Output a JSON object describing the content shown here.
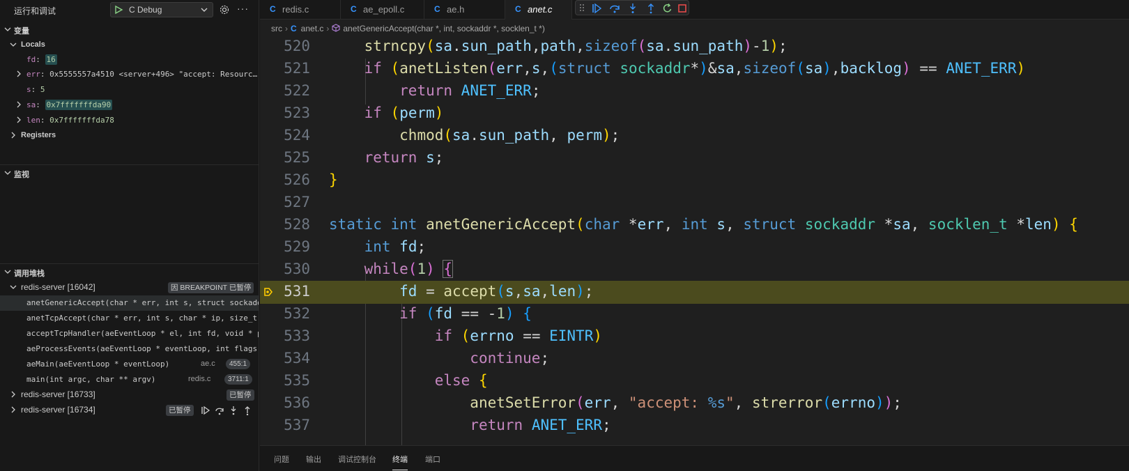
{
  "sidebar": {
    "title": "运行和调试",
    "config": "C Debug",
    "variables": {
      "title": "变量",
      "locals_title": "Locals",
      "items": [
        {
          "name": "fd",
          "value": "16"
        },
        {
          "name": "err",
          "value": "0x5555557a4510 <server+496> \"accept: Resourc…"
        },
        {
          "name": "s",
          "value": "5"
        },
        {
          "name": "sa",
          "value": "0x7fffffffda90"
        },
        {
          "name": "len",
          "value": "0x7fffffffda78"
        }
      ],
      "registers_title": "Registers"
    },
    "watch": {
      "title": "监视"
    },
    "callstack": {
      "title": "调用堆栈",
      "thread1": {
        "name": "redis-server [16042]",
        "status": "因 BREAKPOINT 已暂停"
      },
      "frames": [
        {
          "fn": "anetGenericAccept(char * err, int s, struct sockaddr",
          "file": "",
          "line": ""
        },
        {
          "fn": "anetTcpAccept(char * err, int s, char * ip, size_t",
          "file": "",
          "line": ""
        },
        {
          "fn": "acceptTcpHandler(aeEventLoop * el, int fd, void * p",
          "file": "",
          "line": ""
        },
        {
          "fn": "aeProcessEvents(aeEventLoop * eventLoop, int flags)",
          "file": "",
          "line": ""
        },
        {
          "fn": "aeMain(aeEventLoop * eventLoop)",
          "file": "ae.c",
          "line": "455:1"
        },
        {
          "fn": "main(int argc, char ** argv)",
          "file": "redis.c",
          "line": "3711:1"
        }
      ],
      "thread2": {
        "name": "redis-server [16733]",
        "status": "已暂停"
      },
      "thread3": {
        "name": "redis-server [16734]",
        "status": "已暂停"
      }
    }
  },
  "editor": {
    "tabs": [
      {
        "label": "redis.c"
      },
      {
        "label": "ae_epoll.c"
      },
      {
        "label": "ae.h"
      },
      {
        "label": "anet.c"
      }
    ],
    "breadcrumb": {
      "folder": "src",
      "file": "anet.c",
      "symbol": "anetGenericAccept(char *, int, sockaddr *, socklen_t *)"
    },
    "line_numbers": [
      "520",
      "521",
      "522",
      "523",
      "524",
      "525",
      "526",
      "527",
      "528",
      "529",
      "530",
      "531",
      "532",
      "533",
      "534",
      "535",
      "536",
      "537"
    ],
    "current_line": "531"
  },
  "panel": {
    "tabs": [
      "问题",
      "输出",
      "调试控制台",
      "终端",
      "端口"
    ],
    "active": "终端"
  },
  "colors": {
    "accent": "#3794ff",
    "current_line_bg": "#4b4b1e",
    "breakpoint": "#ffcc00"
  }
}
